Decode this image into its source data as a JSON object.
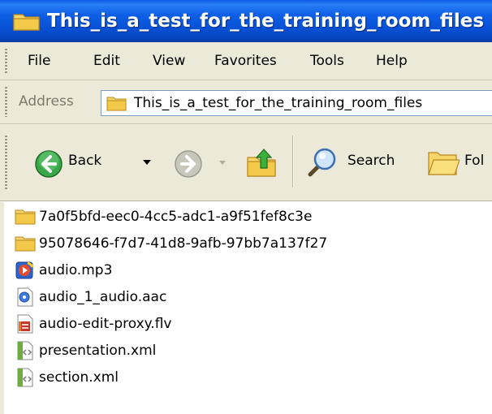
{
  "window": {
    "title": "This_is_a_test_for_the_training_room_files"
  },
  "menu": {
    "items": [
      "File",
      "Edit",
      "View",
      "Favorites",
      "Tools",
      "Help"
    ]
  },
  "address": {
    "label": "Address",
    "value": "This_is_a_test_for_the_training_room_files"
  },
  "toolbar": {
    "back_label": "Back",
    "search_label": "Search",
    "folders_label": "Fol"
  },
  "files": [
    {
      "name": "7a0f5bfd-eec0-4cc5-adc1-a9f51fef8c3e",
      "icon": "folder-icon"
    },
    {
      "name": "95078646-f7d7-41d8-9afb-97bb7a137f27",
      "icon": "folder-icon"
    },
    {
      "name": "audio.mp3",
      "icon": "media-player-icon"
    },
    {
      "name": "audio_1_audio.aac",
      "icon": "audio-file-icon"
    },
    {
      "name": "audio-edit-proxy.flv",
      "icon": "flash-video-icon"
    },
    {
      "name": "presentation.xml",
      "icon": "xml-file-icon"
    },
    {
      "name": "section.xml",
      "icon": "xml-file-icon"
    }
  ],
  "colors": {
    "titlebar": "#0852d6",
    "chrome": "#ece9d8",
    "folder": "#f3cf58"
  }
}
